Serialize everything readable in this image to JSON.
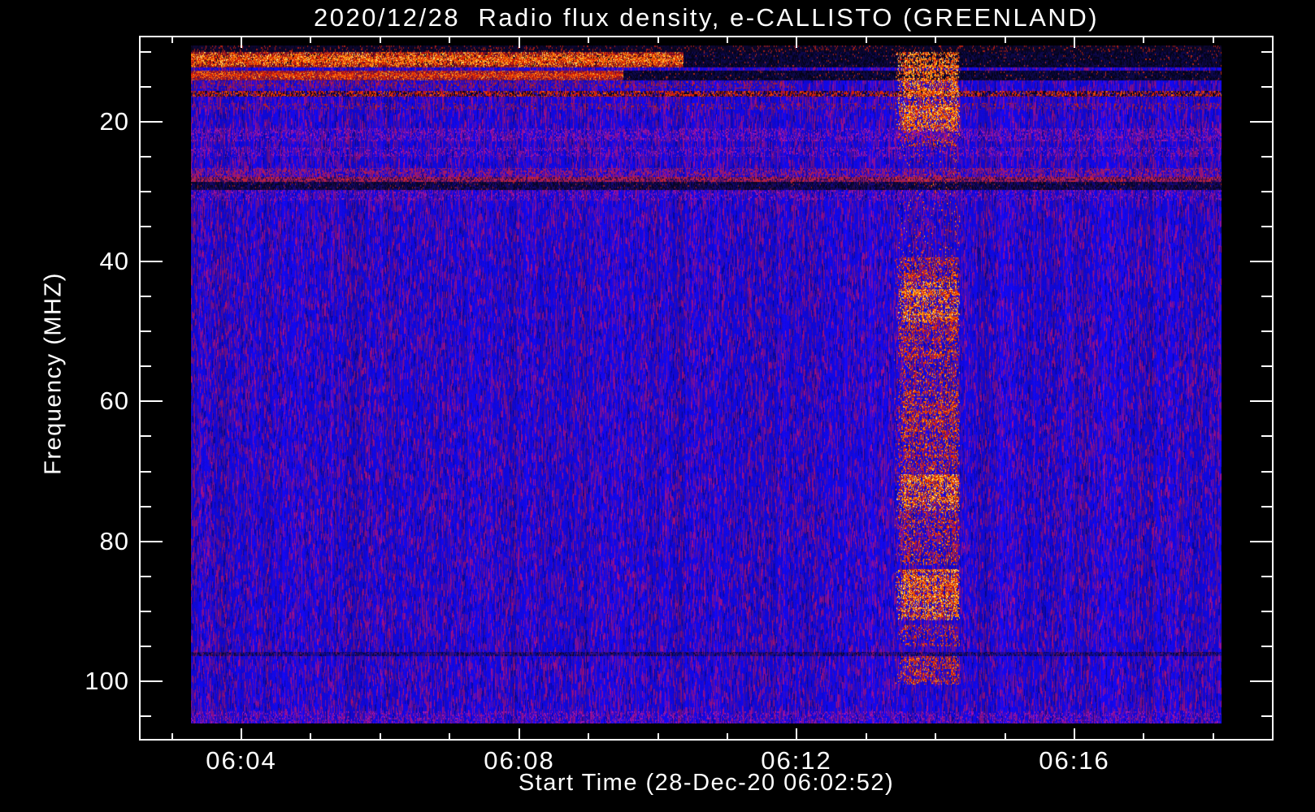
{
  "title": "2020/12/28  Radio flux density, e-CALLISTO (GREENLAND)",
  "chart_data": {
    "type": "heatmap",
    "subtype": "radio-spectrogram",
    "title": "2020/12/28  Radio flux density, e-CALLISTO (GREENLAND)",
    "x_axis": {
      "label": "Start Time (28-Dec-20 06:02:52)",
      "major_ticks": [
        {
          "t_min": 4,
          "label": "06:04"
        },
        {
          "t_min": 8,
          "label": "06:08"
        },
        {
          "t_min": 12,
          "label": "06:12"
        },
        {
          "t_min": 16,
          "label": "06:16"
        }
      ],
      "minor_tick_every_min": 1,
      "minor_range_min": [
        3,
        18
      ],
      "data_start": "06:03:15",
      "data_end": "06:18:07"
    },
    "y_axis": {
      "label": "Frequency (MHZ)",
      "major_ticks": [
        20,
        40,
        60,
        80,
        100
      ],
      "minor_tick_every_mhz": 5,
      "minor_range_mhz": [
        10,
        105
      ],
      "range_mhz": [
        9.1,
        106.1
      ],
      "inverted": true
    },
    "legend": "none",
    "grid": false,
    "colormap": {
      "background_blue": "#1410de",
      "noise_purple": "#7a1ea0",
      "dark_navy": "#0d084a",
      "black": "#040316",
      "red": "#d01a08",
      "orange": "#f56000",
      "yellow": "#ffd028",
      "pale_peak": "#fff0a0"
    },
    "rfi_features": [
      {
        "f0": 9.1,
        "f1": 9.95,
        "style": "topdark",
        "d": 0.12,
        "desc": "near-black top edge rows with sparse red dots"
      },
      {
        "f0": 9.95,
        "f1": 12.2,
        "t0": 3.27,
        "t1": 10.36,
        "style": "hot",
        "d": 0.85,
        "prof": true,
        "desc": "strong broadband RFI band, red/orange/yellow speckle"
      },
      {
        "f0": 9.95,
        "f1": 12.2,
        "t0": 10.36,
        "t1": 18.2,
        "style": "darkdash",
        "d": 0.5,
        "desc": "same band turns dark navy/black after ~06:10"
      },
      {
        "f0": 12.6,
        "f1": 14.0,
        "t0": 3.27,
        "t1": 9.5,
        "style": "red",
        "d": 0.8,
        "prof": true,
        "desc": "second red RFI band on left half"
      },
      {
        "f0": 12.6,
        "f1": 14.0,
        "t0": 9.5,
        "t1": 18.2,
        "style": "darkdash",
        "d": 0.45,
        "desc": "second band dark on right half"
      },
      {
        "f0": 14.2,
        "f1": 15.2,
        "t0": 3.27,
        "t1": 12.0,
        "style": "faintred",
        "d": 0.15,
        "desc": "faint red speckle rows"
      },
      {
        "f0": 15.6,
        "f1": 16.4,
        "style": "redline",
        "d": 0.55,
        "desc": "red/black dashed RFI line across full width (~16 MHz)"
      },
      {
        "f0": 17.3,
        "f1": 18.2,
        "style": "faintred",
        "d": 0.1,
        "desc": "faint red speckle row"
      },
      {
        "f0": 20.9,
        "f1": 22.7,
        "style": "purple",
        "d": 0.3,
        "desc": "purple speckle band (~21-22 MHz)"
      },
      {
        "f0": 23.5,
        "f1": 25.0,
        "style": "purple",
        "d": 0.22,
        "desc": "faint purple band"
      },
      {
        "f0": 26.6,
        "f1": 27.9,
        "style": "purplered",
        "d": 0.4,
        "desc": "purple-red speckled band"
      },
      {
        "f0": 27.9,
        "f1": 28.6,
        "style": "redpurpleline",
        "d": 0.6,
        "desc": "red-purple line (~28 MHz)"
      },
      {
        "f0": 28.6,
        "f1": 29.7,
        "style": "darkband",
        "d": 0.45,
        "desc": "dark navy band (~29 MHz)"
      },
      {
        "f0": 29.7,
        "f1": 31.2,
        "style": "purple",
        "d": 0.2,
        "desc": "purple fade below dark band"
      },
      {
        "f0": 95.8,
        "f1": 96.4,
        "style": "faintdark",
        "d": 0.5,
        "desc": "subtle dark line (~96 MHz)"
      },
      {
        "f0": 104.3,
        "f1": 106.1,
        "style": "purple",
        "d": 0.25,
        "desc": "slightly denser purple speckle at bottom edge"
      }
    ],
    "burst": {
      "desc": "vertical broadband burst column of red/orange/yellow speckle",
      "time_utc": "~06:13:25 - 06:14:20",
      "t0_min": 13.4,
      "t1_min": 14.35,
      "blobs": [
        {
          "f0": 9.95,
          "f1": 15.0,
          "d": 0.65,
          "yellow": true
        },
        {
          "f0": 15.0,
          "f1": 21.3,
          "d": 0.6,
          "yellow": true
        },
        {
          "f0": 21.3,
          "f1": 23.5,
          "d": 0.22,
          "yellow": false
        },
        {
          "f0": 23.5,
          "f1": 39.4,
          "d": 0.05,
          "yellow": false
        },
        {
          "f0": 39.4,
          "f1": 42.8,
          "d": 0.45,
          "yellow": false
        },
        {
          "f0": 42.8,
          "f1": 48.6,
          "d": 0.62,
          "yellow": true
        },
        {
          "f0": 48.6,
          "f1": 53.8,
          "d": 0.42,
          "yellow": false
        },
        {
          "f0": 53.8,
          "f1": 58.5,
          "d": 0.32,
          "yellow": false
        },
        {
          "f0": 58.5,
          "f1": 64.3,
          "d": 0.5,
          "yellow": false
        },
        {
          "f0": 64.3,
          "f1": 68.3,
          "d": 0.42,
          "yellow": false
        },
        {
          "f0": 68.3,
          "f1": 70.2,
          "d": 0.28,
          "yellow": false
        },
        {
          "f0": 70.3,
          "f1": 75.6,
          "d": 0.72,
          "yellow": true
        },
        {
          "f0": 75.6,
          "f1": 83.4,
          "d": 0.38,
          "yellow": false
        },
        {
          "f0": 83.9,
          "f1": 91.2,
          "d": 0.65,
          "yellow": true
        },
        {
          "f0": 91.8,
          "f1": 95.0,
          "d": 0.22,
          "yellow": false
        },
        {
          "f0": 96.4,
          "f1": 100.4,
          "d": 0.45,
          "yellow": false
        }
      ]
    }
  }
}
